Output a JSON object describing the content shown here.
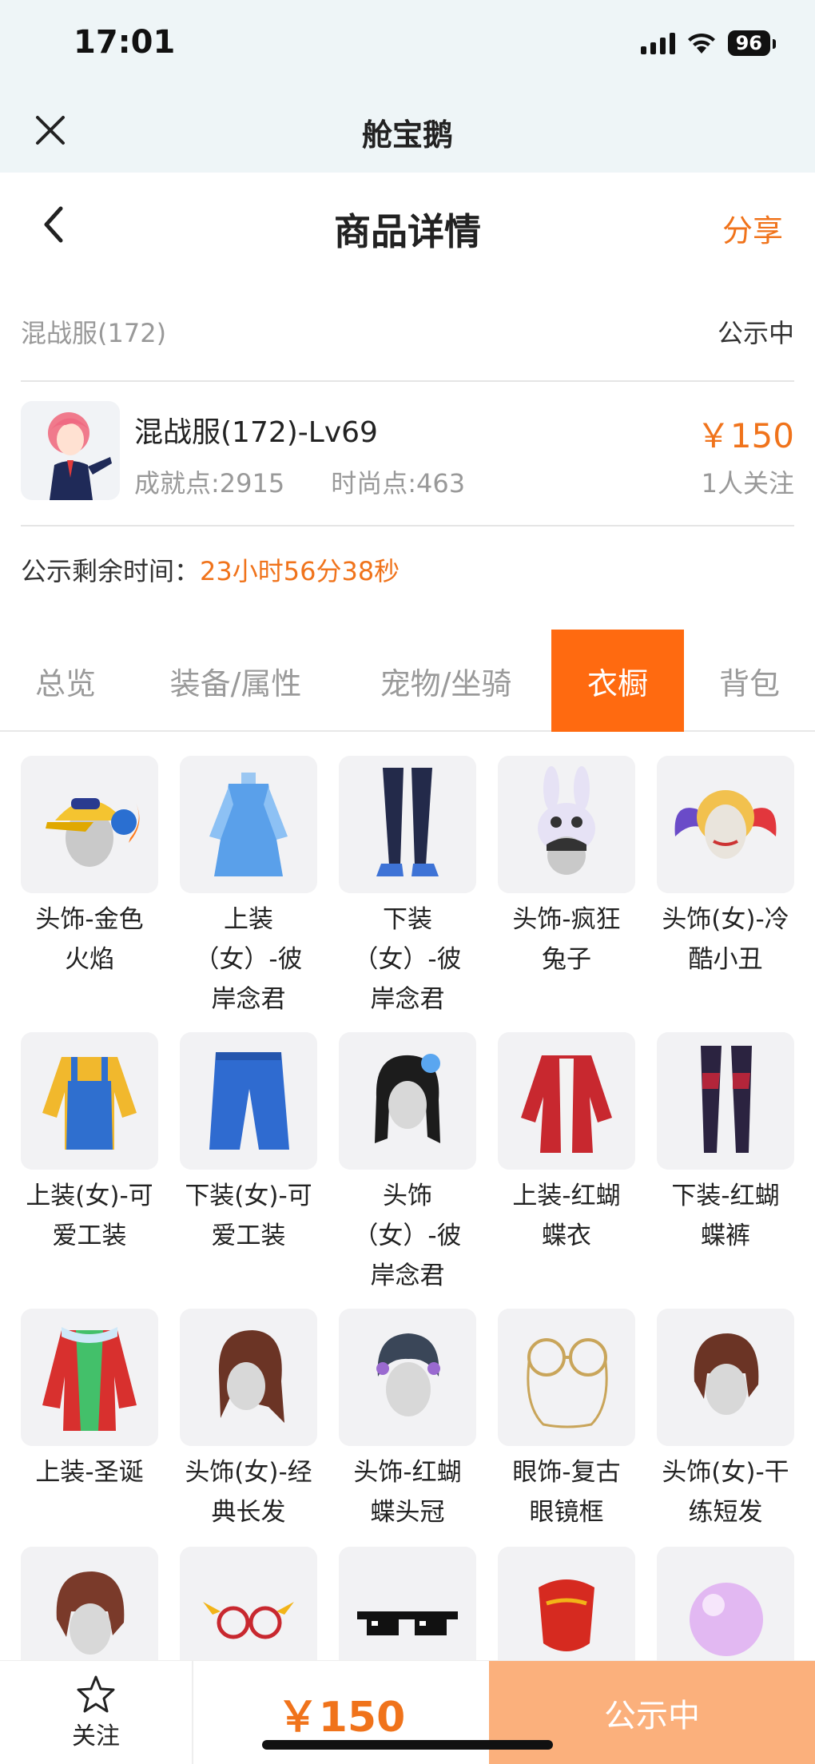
{
  "status_bar": {
    "time": "17:01",
    "battery": "96"
  },
  "miniapp": {
    "title": "舱宝鹅"
  },
  "nav": {
    "title": "商品详情",
    "share_label": "分享"
  },
  "server": {
    "name": "混战服(172)",
    "status": "公示中"
  },
  "product": {
    "name": "混战服(172)-Lv69",
    "achievement": "成就点:2915",
    "fashion": "时尚点:463",
    "price": "￥150",
    "followers": "1人关注"
  },
  "countdown": {
    "label": "公示剩余时间：",
    "value": "23小时56分38秒"
  },
  "tabs": [
    {
      "label": "总览"
    },
    {
      "label": "装备/属性"
    },
    {
      "label": "宠物/坐骑"
    },
    {
      "label": "衣橱",
      "active": true
    },
    {
      "label": "背包"
    }
  ],
  "wardrobe": [
    {
      "label": "头饰-金色火焰",
      "icon": "yellow-cap-icon"
    },
    {
      "label": "上装（女）-彼岸念君",
      "icon": "blue-dress-icon"
    },
    {
      "label": "下装（女）-彼岸念君",
      "icon": "dark-legs-icon"
    },
    {
      "label": "头饰-疯狂兔子",
      "icon": "bunny-hat-icon"
    },
    {
      "label": "头饰(女)-冷酷小丑",
      "icon": "pigtails-icon"
    },
    {
      "label": "上装(女)-可爱工装",
      "icon": "overalls-icon"
    },
    {
      "label": "下装(女)-可爱工装",
      "icon": "jeans-icon"
    },
    {
      "label": "头饰（女）-彼岸念君",
      "icon": "black-hair-icon"
    },
    {
      "label": "上装-红蝴蝶衣",
      "icon": "red-coat-icon"
    },
    {
      "label": "下装-红蝴蝶裤",
      "icon": "red-pants-icon"
    },
    {
      "label": "上装-圣诞",
      "icon": "xmas-coat-icon"
    },
    {
      "label": "头饰(女)-经典长发",
      "icon": "long-hair-icon"
    },
    {
      "label": "头饰-红蝴蝶头冠",
      "icon": "crown-icon"
    },
    {
      "label": "眼饰-复古眼镜框",
      "icon": "round-glasses-icon"
    },
    {
      "label": "头饰(女)-干练短发",
      "icon": "short-hair-icon"
    },
    {
      "label": "",
      "icon": "hair-icon"
    },
    {
      "label": "",
      "icon": "winged-glasses-icon"
    },
    {
      "label": "",
      "icon": "pixel-sunglasses-icon"
    },
    {
      "label": "",
      "icon": "red-mask-icon"
    },
    {
      "label": "",
      "icon": "pink-bubble-icon"
    }
  ],
  "bottom_bar": {
    "follow_label": "关注",
    "price": "￥150",
    "cta_label": "公示中"
  },
  "colors": {
    "accent": "#f0731b",
    "tab_active": "#ff6a10",
    "cta": "#fbb07c"
  }
}
